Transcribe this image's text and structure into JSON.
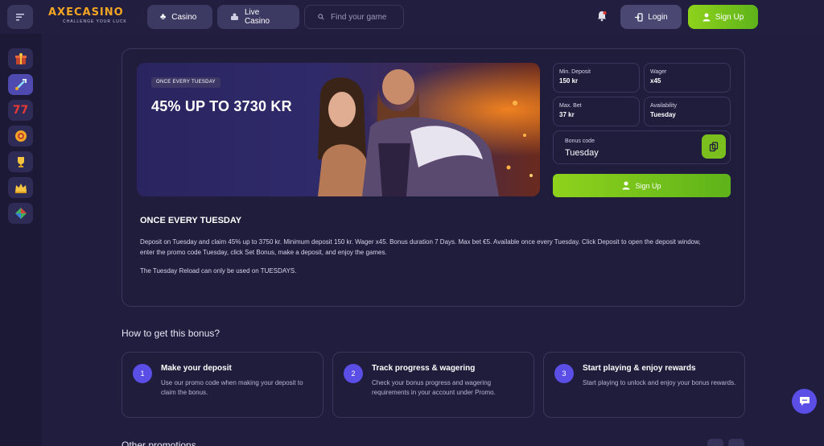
{
  "header": {
    "logo_text": "AXECASINO",
    "logo_tagline": "CHALLENGE YOUR LUCK",
    "nav": [
      {
        "label": "Casino",
        "icon": "club-icon"
      },
      {
        "label": "Live Casino",
        "icon": "dealer-icon"
      }
    ],
    "search_placeholder": "Find your game",
    "login_label": "Login",
    "signup_label": "Sign Up"
  },
  "sidebar": {
    "icons": [
      "gift-box-icon",
      "sword-icon",
      "slot-seven-icon",
      "chip-icon",
      "trophy-icon",
      "crown-icon",
      "gem-icon"
    ]
  },
  "promo": {
    "badge": "ONCE EVERY TUESDAY",
    "title": "45% UP TO 3730 KR",
    "info": [
      {
        "label": "Min. Deposit",
        "value": "150 kr"
      },
      {
        "label": "Wager",
        "value": "x45"
      },
      {
        "label": "Max. Bet",
        "value": "37 kr"
      },
      {
        "label": "Availability",
        "value": "Tuesday"
      }
    ],
    "bonus_code_label": "Bonus code",
    "bonus_code_value": "Tuesday",
    "signup_label": "Sign Up",
    "desc_title": "ONCE EVERY TUESDAY",
    "desc_text": "Deposit on Tuesday and claim 45% up to 3750 kr. Minimum deposit 150 kr. Wager x45. Bonus duration 7 Days. Max bet €5. Available once every Tuesday. Click Deposit to open the deposit window, enter the promo code Tuesday, click Set Bonus, make a deposit, and enjoy the games.",
    "desc_note": "The Tuesday Reload can only be used on TUESDAYS."
  },
  "how": {
    "title": "How to get this bonus?",
    "steps": [
      {
        "num": "1",
        "title": "Make your deposit",
        "text": "Use our promo code when making your deposit to claim the bonus."
      },
      {
        "num": "2",
        "title": "Track progress & wagering",
        "text": "Check your bonus progress and wagering requirements in your account under Promo."
      },
      {
        "num": "3",
        "title": "Start playing & enjoy rewards",
        "text": "Start playing to unlock and enjoy your bonus rewards."
      }
    ]
  },
  "other_title": "Other promotions",
  "colors": {
    "accent_green": "#7bbf1e",
    "accent_purple": "#5b4ee6",
    "brand_orange": "#f5a524"
  }
}
